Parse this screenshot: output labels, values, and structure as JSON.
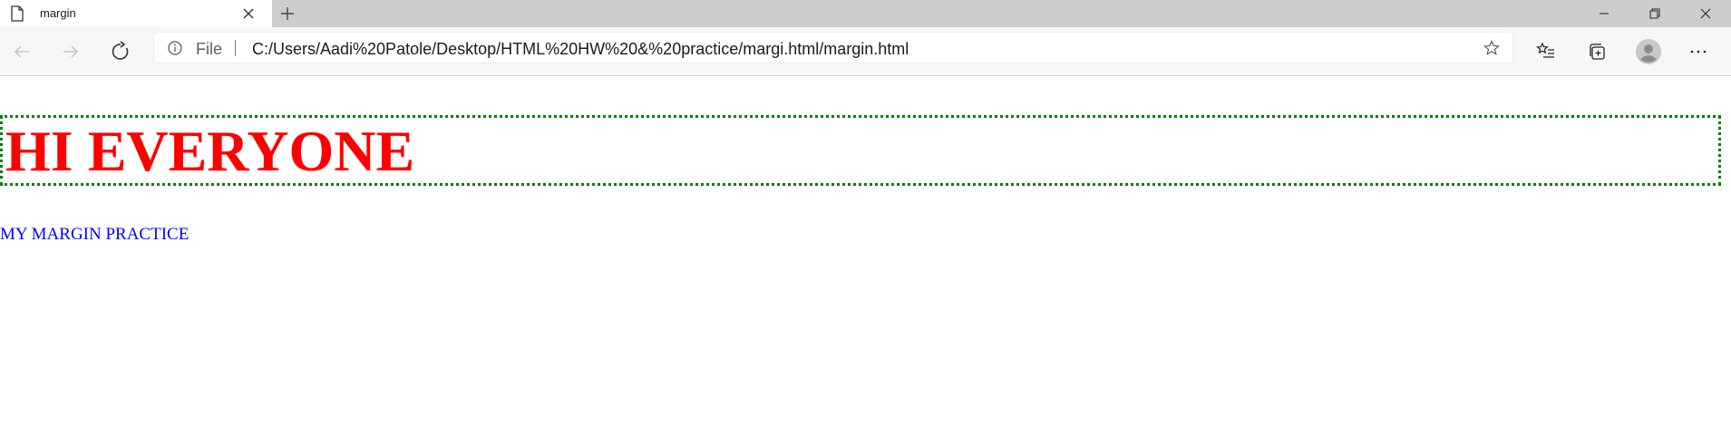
{
  "tab": {
    "title": "margin",
    "page_icon": "page-icon",
    "close_icon": "close-icon",
    "new_tab_icon": "plus-icon"
  },
  "window_controls": {
    "minimize_icon": "minimize-icon",
    "maximize_icon": "restore-icon",
    "close_icon": "close-icon"
  },
  "toolbar": {
    "back_icon": "back-arrow-icon",
    "forward_icon": "forward-arrow-icon",
    "refresh_icon": "refresh-icon",
    "favorites_icon": "favorites-list-icon",
    "collections_icon": "collections-icon",
    "profile_icon": "profile-avatar-icon",
    "more_icon": "more-dots-icon"
  },
  "address_bar": {
    "info_icon": "info-icon",
    "scheme_label": "File",
    "separator": "|",
    "url": "C:/Users/Aadi%20Patole/Desktop/HTML%20HW%20&%20practice/margi.html/margin.html",
    "star_icon": "star-icon"
  },
  "page": {
    "heading": "HI EVERYONE",
    "heading_color": "#ff0000",
    "border_color": "#008000",
    "paragraph": "MY MARGIN PRACTICE",
    "paragraph_color": "#0000ff"
  }
}
